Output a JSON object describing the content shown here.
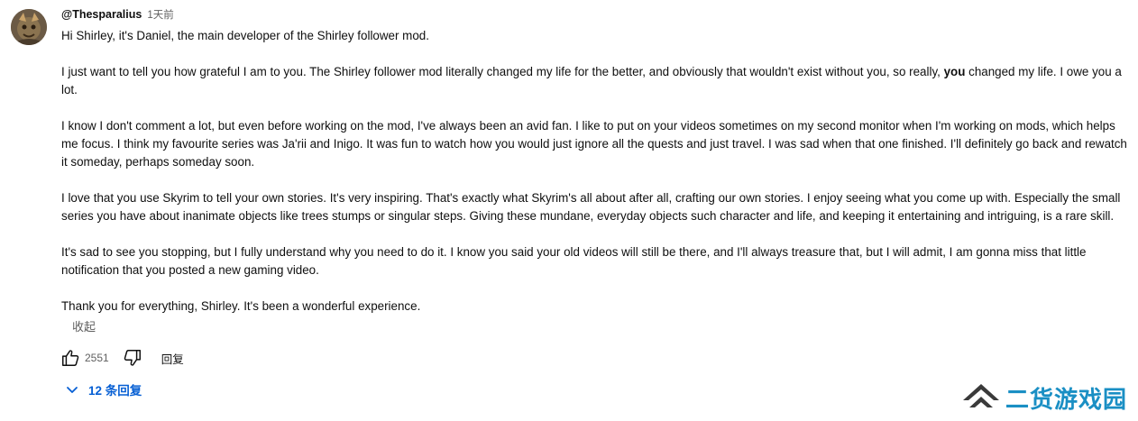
{
  "comment": {
    "author": "@Thesparalius",
    "timestamp": "1天前",
    "paragraphs": [
      {
        "text": "Hi Shirley, it's Daniel, the main developer of the Shirley follower mod."
      },
      {
        "pre": "I just want to tell you how grateful I am to you. The Shirley follower mod literally changed my life for the better, and obviously that wouldn't exist without you, so really, ",
        "bold": "you",
        "post": " changed my life. I owe you a lot."
      },
      {
        "text": "I know I don't comment a lot, but even before working on the mod, I've always been an avid fan. I like to put on your videos sometimes on my second monitor when I'm working on mods, which helps me focus. I think my favourite series was Ja'rii and Inigo. It was fun to watch how you would just ignore all the quests and just travel. I was sad when that one finished. I'll definitely go back and rewatch it someday, perhaps someday soon."
      },
      {
        "text": "I love that you use Skyrim to tell your own stories. It's very inspiring. That's exactly what Skyrim's all about after all, crafting our own stories. I enjoy seeing what you come up with. Especially the small series you have about inanimate objects like trees stumps or singular steps. Giving these mundane, everyday objects such character and life, and keeping it entertaining and intriguing, is a rare skill."
      },
      {
        "text": "It's sad to see you stopping, but I fully understand why you need to do it. I know you said your old videos will still be there, and I'll always treasure that, but I will admit, I am gonna miss that little notification that you posted a new gaming video."
      },
      {
        "text": "Thank you for everything, Shirley. It's been a wonderful experience."
      }
    ],
    "collapse_label": "收起",
    "like_count": "2551",
    "reply_label": "回复",
    "replies_label": "12 条回复"
  },
  "icons": {
    "like": "thumbs-up-icon",
    "dislike": "thumbs-down-icon",
    "replies": "chevron-down-icon"
  },
  "watermark": {
    "text": "二货游戏园"
  },
  "colors": {
    "link_blue": "#065fd4",
    "secondary_text": "#606060",
    "watermark_blue": "#1a8fc4",
    "watermark_dark": "#3a3a3a"
  }
}
